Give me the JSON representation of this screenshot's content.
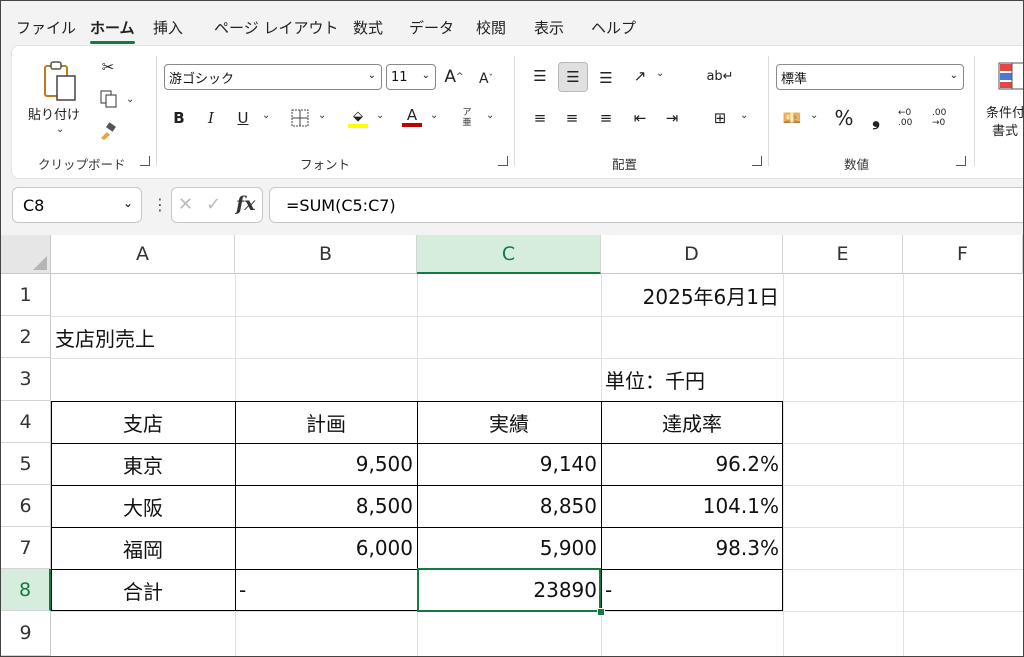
{
  "menu": {
    "tabs": [
      "ファイル",
      "ホーム",
      "挿入",
      "ページ レイアウト",
      "数式",
      "データ",
      "校閲",
      "表示",
      "ヘルプ"
    ],
    "active": "ホーム"
  },
  "ribbon": {
    "clipboard": {
      "paste_label": "貼り付け",
      "group_label": "クリップボード"
    },
    "font": {
      "font_name": "游ゴシック",
      "font_size": "11",
      "bold": "B",
      "italic": "I",
      "underline": "U",
      "grow": "A",
      "shrink": "A",
      "font_color": "A",
      "group_label": "フォント"
    },
    "alignment": {
      "group_label": "配置"
    },
    "number": {
      "format": "標準",
      "percent": "%",
      "comma": "❟",
      "inc_decimal": "←0 .00",
      "dec_decimal": ".00 →0",
      "group_label": "数値"
    },
    "styles": {
      "cond_format_line1": "条件付",
      "cond_format_line2": "書式"
    },
    "colors": {
      "accent": "#107c41",
      "highlight_yellow": "#ffff00",
      "font_red": "#c00000"
    }
  },
  "formula_bar": {
    "name_box": "C8",
    "formula": "=SUM(C5:C7)",
    "fx": "fx"
  },
  "sheet": {
    "columns": [
      "A",
      "B",
      "C",
      "D",
      "E",
      "F"
    ],
    "rows": [
      "1",
      "2",
      "3",
      "4",
      "5",
      "6",
      "7",
      "8",
      "9"
    ],
    "selected_cell": "C8",
    "cells": {
      "D1": "2025年6月1日",
      "A2": "支店別売上",
      "D3": "単位：千円",
      "A4": "支店",
      "B4": "計画",
      "C4": "実績",
      "D4": "達成率",
      "A5": "東京",
      "B5": "9,500",
      "C5": "9,140",
      "D5": "96.2%",
      "A6": "大阪",
      "B6": "8,500",
      "C6": "8,850",
      "D6": "104.1%",
      "A7": "福岡",
      "B7": "6,000",
      "C7": "5,900",
      "D7": "98.3%",
      "A8": "合計",
      "B8": "-",
      "C8": "23890",
      "D8": "-"
    }
  }
}
